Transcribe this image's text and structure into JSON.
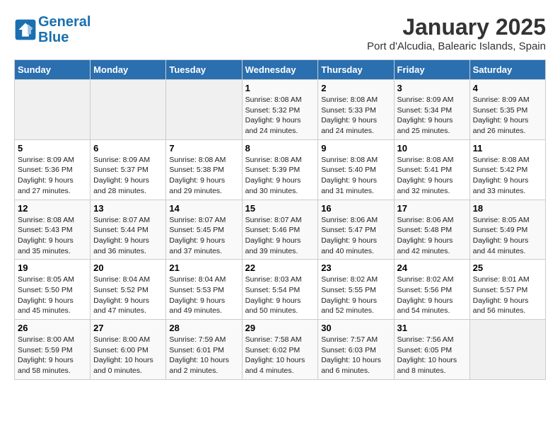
{
  "header": {
    "logo_line1": "General",
    "logo_line2": "Blue",
    "title": "January 2025",
    "subtitle": "Port d'Alcudia, Balearic Islands, Spain"
  },
  "days_of_week": [
    "Sunday",
    "Monday",
    "Tuesday",
    "Wednesday",
    "Thursday",
    "Friday",
    "Saturday"
  ],
  "weeks": [
    [
      {
        "day": "",
        "info": ""
      },
      {
        "day": "",
        "info": ""
      },
      {
        "day": "",
        "info": ""
      },
      {
        "day": "1",
        "info": "Sunrise: 8:08 AM\nSunset: 5:32 PM\nDaylight: 9 hours\nand 24 minutes."
      },
      {
        "day": "2",
        "info": "Sunrise: 8:08 AM\nSunset: 5:33 PM\nDaylight: 9 hours\nand 24 minutes."
      },
      {
        "day": "3",
        "info": "Sunrise: 8:09 AM\nSunset: 5:34 PM\nDaylight: 9 hours\nand 25 minutes."
      },
      {
        "day": "4",
        "info": "Sunrise: 8:09 AM\nSunset: 5:35 PM\nDaylight: 9 hours\nand 26 minutes."
      }
    ],
    [
      {
        "day": "5",
        "info": "Sunrise: 8:09 AM\nSunset: 5:36 PM\nDaylight: 9 hours\nand 27 minutes."
      },
      {
        "day": "6",
        "info": "Sunrise: 8:09 AM\nSunset: 5:37 PM\nDaylight: 9 hours\nand 28 minutes."
      },
      {
        "day": "7",
        "info": "Sunrise: 8:08 AM\nSunset: 5:38 PM\nDaylight: 9 hours\nand 29 minutes."
      },
      {
        "day": "8",
        "info": "Sunrise: 8:08 AM\nSunset: 5:39 PM\nDaylight: 9 hours\nand 30 minutes."
      },
      {
        "day": "9",
        "info": "Sunrise: 8:08 AM\nSunset: 5:40 PM\nDaylight: 9 hours\nand 31 minutes."
      },
      {
        "day": "10",
        "info": "Sunrise: 8:08 AM\nSunset: 5:41 PM\nDaylight: 9 hours\nand 32 minutes."
      },
      {
        "day": "11",
        "info": "Sunrise: 8:08 AM\nSunset: 5:42 PM\nDaylight: 9 hours\nand 33 minutes."
      }
    ],
    [
      {
        "day": "12",
        "info": "Sunrise: 8:08 AM\nSunset: 5:43 PM\nDaylight: 9 hours\nand 35 minutes."
      },
      {
        "day": "13",
        "info": "Sunrise: 8:07 AM\nSunset: 5:44 PM\nDaylight: 9 hours\nand 36 minutes."
      },
      {
        "day": "14",
        "info": "Sunrise: 8:07 AM\nSunset: 5:45 PM\nDaylight: 9 hours\nand 37 minutes."
      },
      {
        "day": "15",
        "info": "Sunrise: 8:07 AM\nSunset: 5:46 PM\nDaylight: 9 hours\nand 39 minutes."
      },
      {
        "day": "16",
        "info": "Sunrise: 8:06 AM\nSunset: 5:47 PM\nDaylight: 9 hours\nand 40 minutes."
      },
      {
        "day": "17",
        "info": "Sunrise: 8:06 AM\nSunset: 5:48 PM\nDaylight: 9 hours\nand 42 minutes."
      },
      {
        "day": "18",
        "info": "Sunrise: 8:05 AM\nSunset: 5:49 PM\nDaylight: 9 hours\nand 44 minutes."
      }
    ],
    [
      {
        "day": "19",
        "info": "Sunrise: 8:05 AM\nSunset: 5:50 PM\nDaylight: 9 hours\nand 45 minutes."
      },
      {
        "day": "20",
        "info": "Sunrise: 8:04 AM\nSunset: 5:52 PM\nDaylight: 9 hours\nand 47 minutes."
      },
      {
        "day": "21",
        "info": "Sunrise: 8:04 AM\nSunset: 5:53 PM\nDaylight: 9 hours\nand 49 minutes."
      },
      {
        "day": "22",
        "info": "Sunrise: 8:03 AM\nSunset: 5:54 PM\nDaylight: 9 hours\nand 50 minutes."
      },
      {
        "day": "23",
        "info": "Sunrise: 8:02 AM\nSunset: 5:55 PM\nDaylight: 9 hours\nand 52 minutes."
      },
      {
        "day": "24",
        "info": "Sunrise: 8:02 AM\nSunset: 5:56 PM\nDaylight: 9 hours\nand 54 minutes."
      },
      {
        "day": "25",
        "info": "Sunrise: 8:01 AM\nSunset: 5:57 PM\nDaylight: 9 hours\nand 56 minutes."
      }
    ],
    [
      {
        "day": "26",
        "info": "Sunrise: 8:00 AM\nSunset: 5:59 PM\nDaylight: 9 hours\nand 58 minutes."
      },
      {
        "day": "27",
        "info": "Sunrise: 8:00 AM\nSunset: 6:00 PM\nDaylight: 10 hours\nand 0 minutes."
      },
      {
        "day": "28",
        "info": "Sunrise: 7:59 AM\nSunset: 6:01 PM\nDaylight: 10 hours\nand 2 minutes."
      },
      {
        "day": "29",
        "info": "Sunrise: 7:58 AM\nSunset: 6:02 PM\nDaylight: 10 hours\nand 4 minutes."
      },
      {
        "day": "30",
        "info": "Sunrise: 7:57 AM\nSunset: 6:03 PM\nDaylight: 10 hours\nand 6 minutes."
      },
      {
        "day": "31",
        "info": "Sunrise: 7:56 AM\nSunset: 6:05 PM\nDaylight: 10 hours\nand 8 minutes."
      },
      {
        "day": "",
        "info": ""
      }
    ]
  ]
}
